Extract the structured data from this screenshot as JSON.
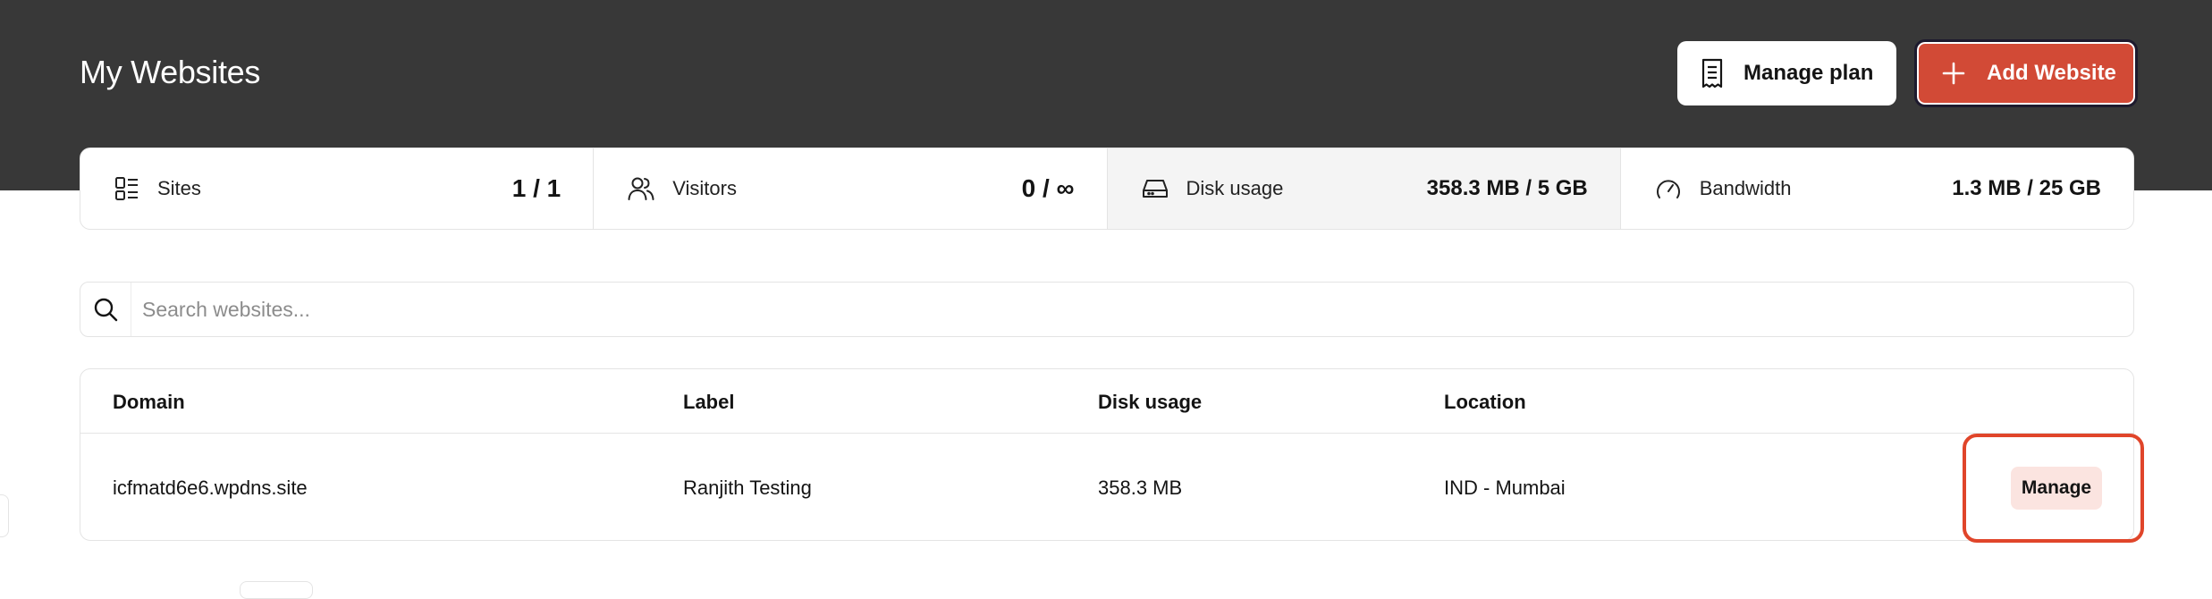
{
  "header": {
    "title": "My Websites",
    "manage_plan_label": "Manage plan",
    "add_website_label": "Add Website",
    "accent_color": "#d24a36",
    "background_color": "#383838"
  },
  "stats": [
    {
      "label": "Sites",
      "value": "1 / 1",
      "icon": "sites-grid-icon"
    },
    {
      "label": "Visitors",
      "value": "0 / ∞",
      "icon": "users-icon"
    },
    {
      "label": "Disk usage",
      "value": "358.3 MB / 5 GB",
      "icon": "hard-drive-icon"
    },
    {
      "label": "Bandwidth",
      "value": "1.3 MB / 25 GB",
      "icon": "speedometer-icon"
    }
  ],
  "search": {
    "placeholder": "Search websites..."
  },
  "table": {
    "columns": [
      "Domain",
      "Label",
      "Disk usage",
      "Location"
    ],
    "rows": [
      {
        "domain": "icfmatd6e6.wpdns.site",
        "label": "Ranjith Testing",
        "disk_usage": "358.3 MB",
        "location": "IND - Mumbai",
        "action": "Manage"
      }
    ]
  }
}
